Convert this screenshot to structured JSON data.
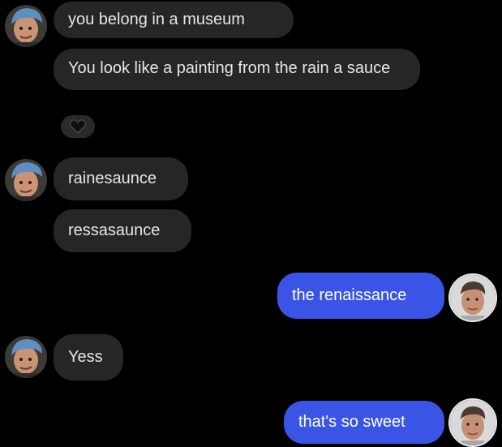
{
  "messages": [
    {
      "sender": "them",
      "text": "you belong in a museum"
    },
    {
      "sender": "them",
      "text": "You look like a painting from the rain a sauce",
      "reaction": "black-heart"
    },
    {
      "sender": "them",
      "text": "rainesaunce"
    },
    {
      "sender": "them",
      "text": "ressasaunce"
    },
    {
      "sender": "me",
      "text": "the renaissance"
    },
    {
      "sender": "them",
      "text": "Yess"
    },
    {
      "sender": "me",
      "text": "that's so sweet"
    }
  ],
  "colors": {
    "background": "#000000",
    "incoming_bubble": "#262629",
    "incoming_text": "#e6e6e6",
    "outgoing_bubble": "#3a55e6",
    "outgoing_text": "#ffffff"
  },
  "icons": {
    "reaction": "black-heart-icon",
    "contact_avatar": "avatar-man-blue-beanie",
    "user_avatar": "avatar-man-short-hair"
  }
}
